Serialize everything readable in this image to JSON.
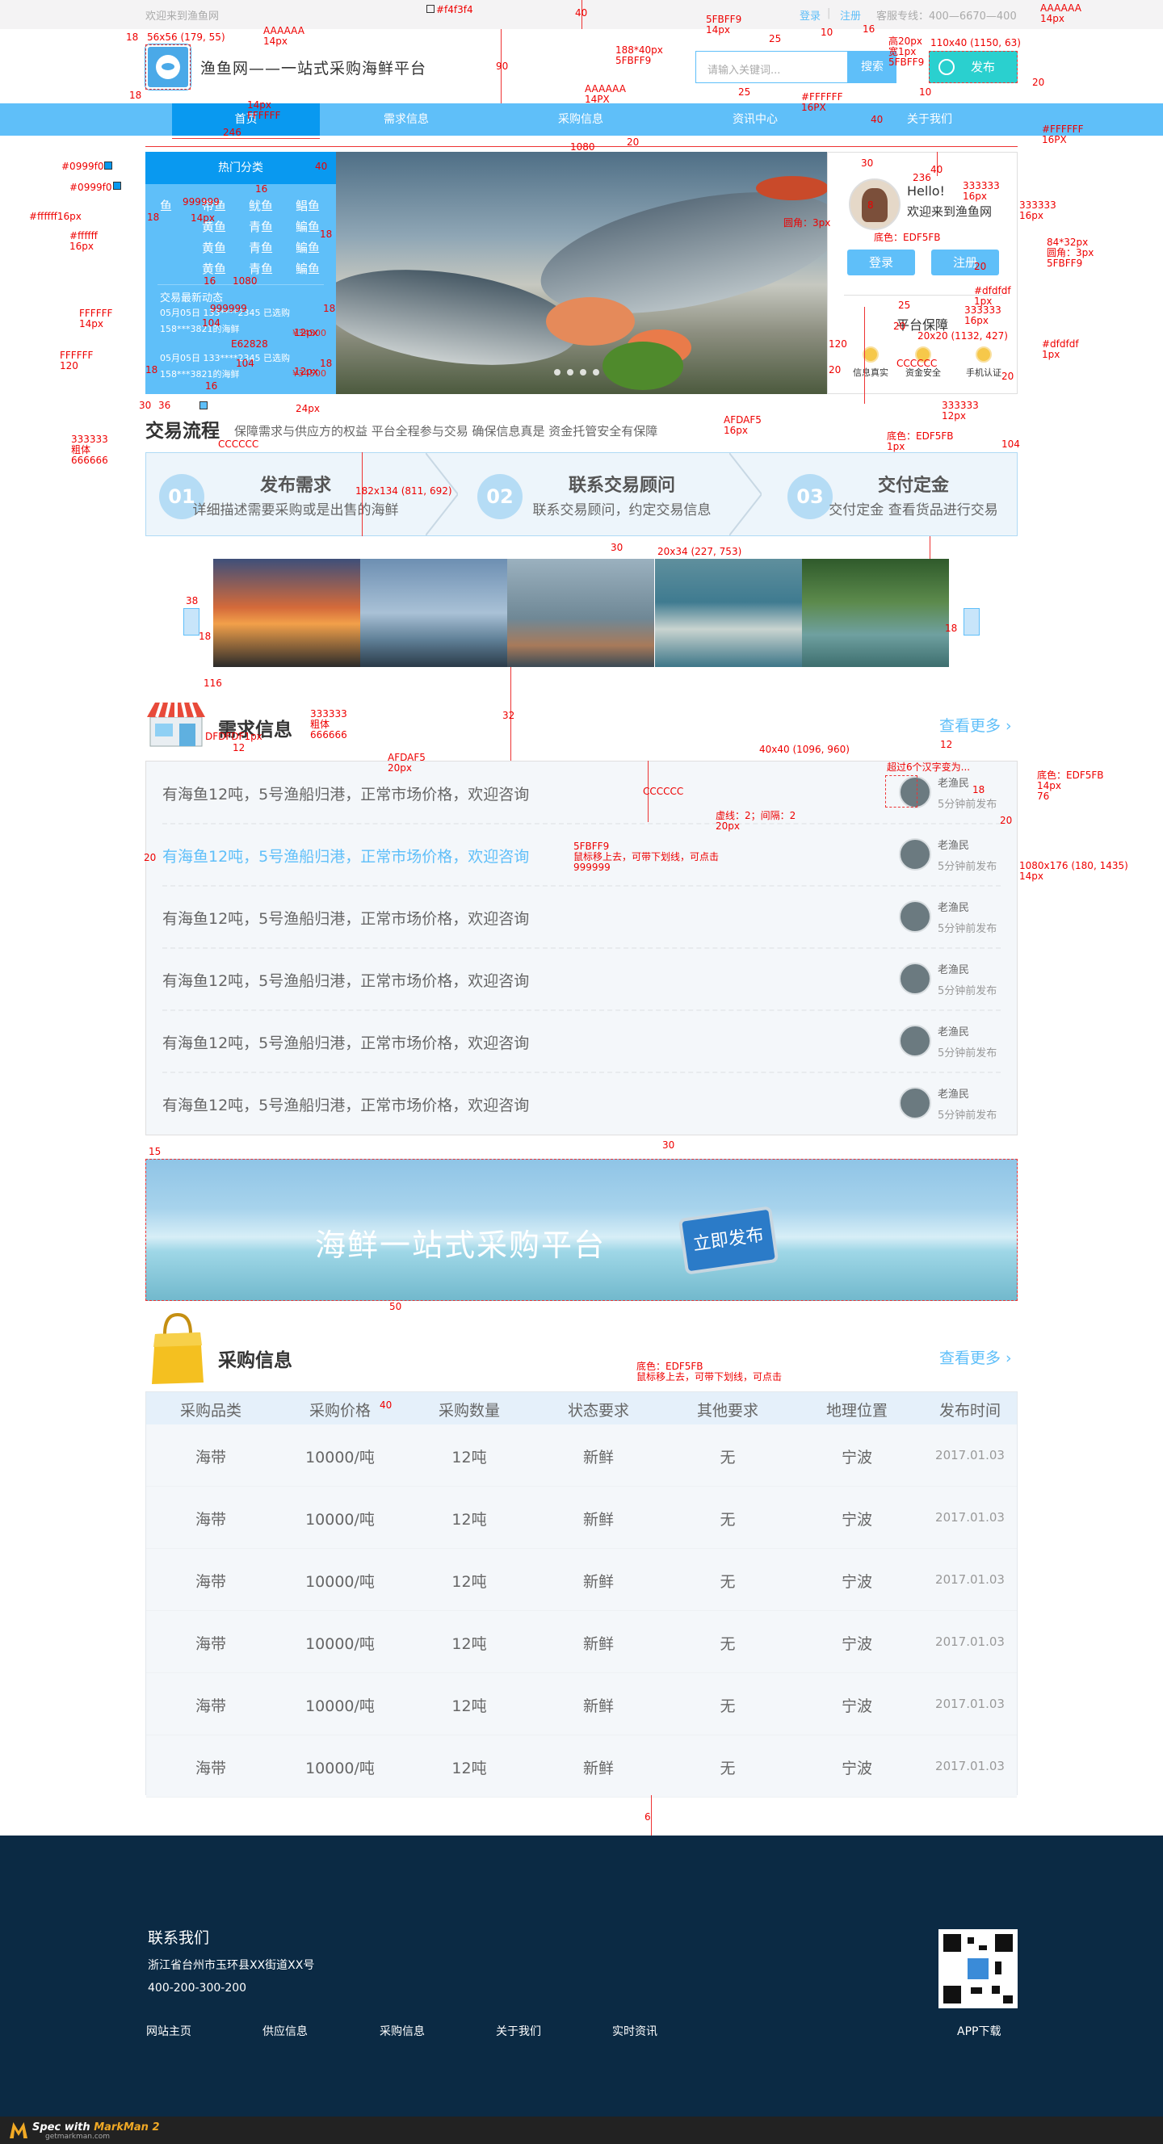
{
  "topbar": {
    "welcome": "欢迎来到渔鱼网",
    "login": "登录",
    "divider": "|",
    "register": "注册",
    "hotline": "客服专线：400—6670—400"
  },
  "header": {
    "site_title": "渔鱼网——一站式采购海鲜平台",
    "search_placeholder": "请输入关键词...",
    "search_label": "搜索",
    "publish_label": "发布"
  },
  "nav": {
    "items": [
      "首页",
      "需求信息",
      "采购信息",
      "资讯中心",
      "关于我们"
    ],
    "active": "首页"
  },
  "categories": {
    "title": "热门分类",
    "rows": [
      [
        "鱼",
        "带鱼",
        "鱿鱼",
        "鲳鱼"
      ],
      [
        "",
        "黄鱼",
        "青鱼",
        "鳊鱼"
      ],
      [
        "",
        "黄鱼",
        "青鱼",
        "鳊鱼"
      ],
      [
        "",
        "黄鱼",
        "青鱼",
        "鳊鱼"
      ]
    ],
    "news_title": "交易最新动态",
    "news": [
      {
        "text": "05月05日 133****2345 已选购158***3821的海鲜",
        "price": "¥34500"
      },
      {
        "text": "05月05日 133****2345 已选购158***3821的海鲜",
        "price": "¥34500"
      }
    ]
  },
  "userbox": {
    "hello": "Hello!",
    "welcome": "欢迎来到渔鱼网",
    "login_label": "登录",
    "register_label": "注册",
    "guarantee_title": "平台保障",
    "guarantees": [
      "信息真实",
      "资金安全",
      "手机认证"
    ]
  },
  "flow": {
    "title": "交易流程",
    "subtitle": "保障需求与供应方的权益   平台全程参与交易   确保信息真是   资金托管安全有保障",
    "steps": [
      {
        "num": "01",
        "title": "发布需求",
        "desc": "详细描述需要采购或是出售的海鲜"
      },
      {
        "num": "02",
        "title": "联系交易顾问",
        "desc": "联系交易顾问，约定交易信息"
      },
      {
        "num": "03",
        "title": "交付定金",
        "desc": "交付定金  查看货品进行交易"
      }
    ]
  },
  "demand": {
    "title": "需求信息",
    "more": "查看更多 ›",
    "items": [
      {
        "text": "有海鱼12吨，5号渔船归港，正常市场价格，欢迎咨询",
        "user": "老渔民",
        "time": "5分钟前发布",
        "hover": false
      },
      {
        "text": "有海鱼12吨，5号渔船归港，正常市场价格，欢迎咨询",
        "user": "老渔民",
        "time": "5分钟前发布",
        "hover": true
      },
      {
        "text": "有海鱼12吨，5号渔船归港，正常市场价格，欢迎咨询",
        "user": "老渔民",
        "time": "5分钟前发布",
        "hover": false
      },
      {
        "text": "有海鱼12吨，5号渔船归港，正常市场价格，欢迎咨询",
        "user": "老渔民",
        "time": "5分钟前发布",
        "hover": false
      },
      {
        "text": "有海鱼12吨，5号渔船归港，正常市场价格，欢迎咨询",
        "user": "老渔民",
        "time": "5分钟前发布",
        "hover": false
      },
      {
        "text": "有海鱼12吨，5号渔船归港，正常市场价格，欢迎咨询",
        "user": "老渔民",
        "time": "5分钟前发布",
        "hover": false
      }
    ]
  },
  "promo": {
    "text": "海鲜一站式采购平台",
    "button": "立即发布"
  },
  "purchase": {
    "title": "采购信息",
    "more": "查看更多 ›",
    "headers": [
      "采购品类",
      "采购价格",
      "采购数量",
      "状态要求",
      "其他要求",
      "地理位置",
      "发布时间"
    ],
    "rows": [
      [
        "海带",
        "10000/吨",
        "12吨",
        "新鲜",
        "无",
        "宁波",
        "2017.01.03"
      ],
      [
        "海带",
        "10000/吨",
        "12吨",
        "新鲜",
        "无",
        "宁波",
        "2017.01.03"
      ],
      [
        "海带",
        "10000/吨",
        "12吨",
        "新鲜",
        "无",
        "宁波",
        "2017.01.03"
      ],
      [
        "海带",
        "10000/吨",
        "12吨",
        "新鲜",
        "无",
        "宁波",
        "2017.01.03"
      ],
      [
        "海带",
        "10000/吨",
        "12吨",
        "新鲜",
        "无",
        "宁波",
        "2017.01.03"
      ],
      [
        "海带",
        "10000/吨",
        "12吨",
        "新鲜",
        "无",
        "宁波",
        "2017.01.03"
      ]
    ]
  },
  "footer": {
    "contact_title": "联系我们",
    "address": "浙江省台州市玉环县XX街道XX号",
    "phone": "400-200-300-200",
    "links": [
      "网站主页",
      "供应信息",
      "采购信息",
      "关于我们",
      "实时资讯"
    ],
    "app_download": "APP下载"
  },
  "markman": {
    "brand_prefix": "Spec with ",
    "brand_name": "MarkMan 2",
    "url": "getmarkman.com"
  },
  "colors": {
    "primary": "#5fbff9",
    "dark_blue": "#0999f0",
    "topbar_bg": "#f4f3f4",
    "footer_bg": "#0b2a44",
    "price_red": "#e62828",
    "annotation_red": "#ff0000"
  },
  "annotations": [
    "#f4f3f4",
    "AAAAAA",
    "14px",
    "18",
    "56x56 (179, 55)",
    "40",
    "5FBFF9",
    "25",
    "10",
    "16",
    "高20px",
    "宽1px",
    "110x40 (1150, 63)",
    "188*40px",
    "90",
    "14px",
    "FFFFFF",
    "#FFFFFF",
    "16PX",
    "246",
    "20",
    "1080",
    "30",
    "236",
    "#0999f0",
    "#ffffff16px",
    "#ffffff",
    "16px",
    "333333",
    "8",
    "84*32px",
    "圆角：3px",
    "#dfdfdf",
    "1px",
    "20x20 (1132, 427)",
    "E62828",
    "FFFFFF",
    "12px",
    "120",
    "12px",
    "#5fbff9",
    "36",
    "24px",
    "粗体",
    "666666",
    "AFDAF5",
    "底色：EDF5FB",
    "104",
    "182x134 (811, 692)",
    "20x34 (227, 753)",
    "38",
    "116",
    "32",
    "12",
    "DFDFDF1px",
    "40x40 (1096, 960)",
    "超过6个汉字变为...",
    "76",
    "CCCCCC",
    "虚线：2；间隔：2",
    "20px",
    "鼠标移上去，可带下划线，可点击",
    "999999",
    "1080x176 (180, 1435)",
    "15",
    "50",
    "6"
  ]
}
